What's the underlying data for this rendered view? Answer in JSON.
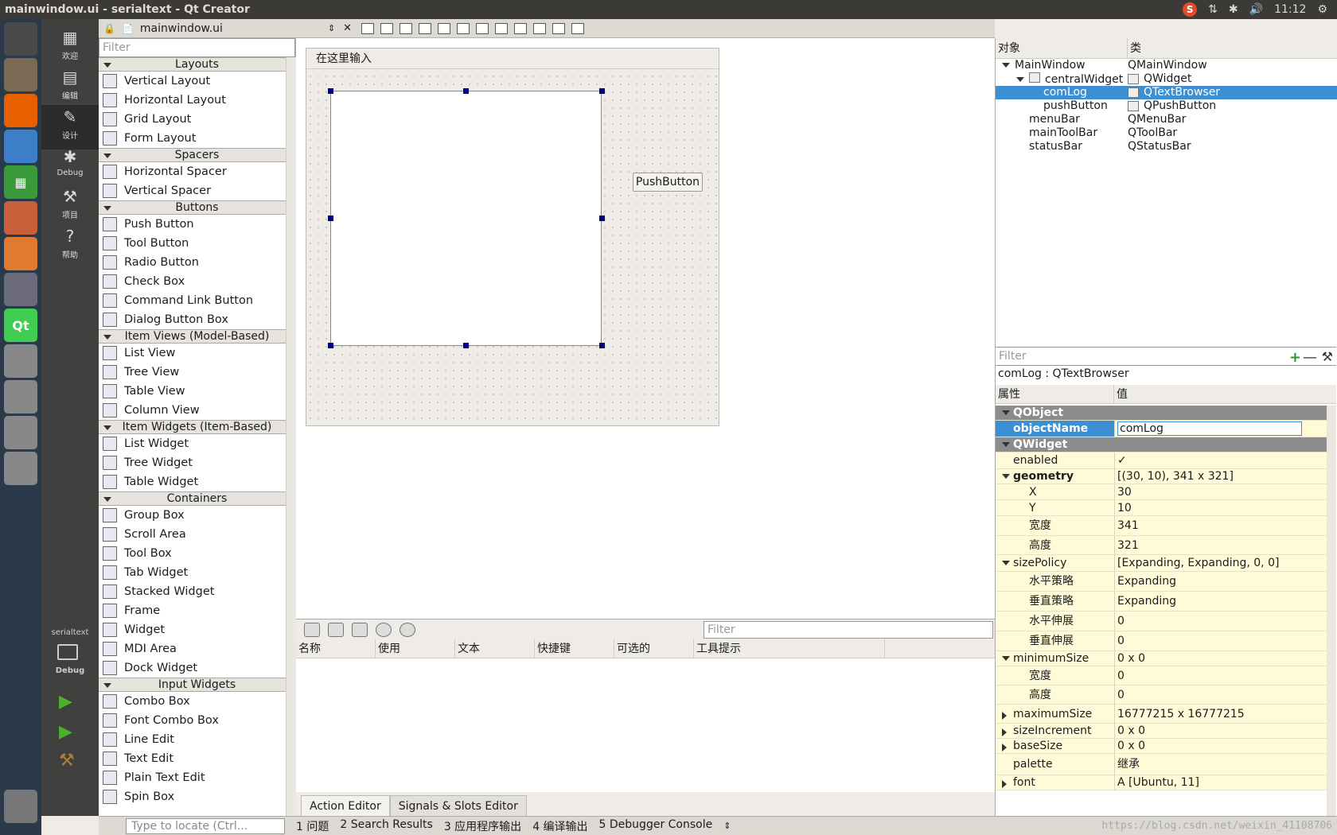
{
  "window": {
    "title": "mainwindow.ui - serialtext - Qt Creator",
    "time": "11:12"
  },
  "tray": {
    "sogou_label": "S"
  },
  "launcher": {
    "items": [
      "dash-icon",
      "files-icon",
      "firefox-icon",
      "writer-icon",
      "calc-icon",
      "impress-icon",
      "software-icon",
      "settings-icon",
      "qt-icon",
      "drive-icon",
      "drive-icon",
      "drive-icon",
      "drive-icon",
      "trash-icon"
    ],
    "qt_label": "Qt",
    "calc_label": "▦"
  },
  "modes": [
    {
      "label": "欢迎",
      "icon": "▦"
    },
    {
      "label": "编辑",
      "icon": "▤"
    },
    {
      "label": "设计",
      "icon": "✎"
    },
    {
      "label": "Debug",
      "icon": "✱"
    },
    {
      "label": "项目",
      "icon": "⚒"
    },
    {
      "label": "帮助",
      "icon": "?"
    }
  ],
  "kit": {
    "project": "serialtext",
    "mode": "Debug"
  },
  "runbar": {
    "run_icon": "▶",
    "debug_icon": "▶",
    "build_icon": "⚒"
  },
  "filetab": {
    "name": "mainwindow.ui"
  },
  "widgetbox": {
    "filter_placeholder": "Filter",
    "categories": [
      {
        "name": "Layouts",
        "items": [
          "Vertical Layout",
          "Horizontal Layout",
          "Grid Layout",
          "Form Layout"
        ]
      },
      {
        "name": "Spacers",
        "items": [
          "Horizontal Spacer",
          "Vertical Spacer"
        ]
      },
      {
        "name": "Buttons",
        "items": [
          "Push Button",
          "Tool Button",
          "Radio Button",
          "Check Box",
          "Command Link Button",
          "Dialog Button Box"
        ]
      },
      {
        "name": "Item Views (Model-Based)",
        "items": [
          "List View",
          "Tree View",
          "Table View",
          "Column View"
        ]
      },
      {
        "name": "Item Widgets (Item-Based)",
        "items": [
          "List Widget",
          "Tree Widget",
          "Table Widget"
        ]
      },
      {
        "name": "Containers",
        "items": [
          "Group Box",
          "Scroll Area",
          "Tool Box",
          "Tab Widget",
          "Stacked Widget",
          "Frame",
          "Widget",
          "MDI Area",
          "Dock Widget"
        ]
      },
      {
        "name": "Input Widgets",
        "items": [
          "Combo Box",
          "Font Combo Box",
          "Line Edit",
          "Text Edit",
          "Plain Text Edit",
          "Spin Box"
        ]
      }
    ]
  },
  "form": {
    "menu_placeholder": "在这里输入",
    "push_button": "PushButton"
  },
  "action_editor": {
    "filter_placeholder": "Filter",
    "columns": [
      "名称",
      "使用",
      "文本",
      "快捷键",
      "可选的",
      "工具提示"
    ],
    "tabs": [
      "Action Editor",
      "Signals & Slots Editor"
    ]
  },
  "object_inspector": {
    "col_object": "对象",
    "col_class": "类",
    "rows": [
      {
        "name": "MainWindow",
        "cls": "QMainWindow",
        "depth": 0,
        "expanded": true
      },
      {
        "name": "centralWidget",
        "cls": "QWidget",
        "depth": 1,
        "expanded": true
      },
      {
        "name": "comLog",
        "cls": "QTextBrowser",
        "depth": 2,
        "selected": true
      },
      {
        "name": "pushButton",
        "cls": "QPushButton",
        "depth": 2
      },
      {
        "name": "menuBar",
        "cls": "QMenuBar",
        "depth": 1
      },
      {
        "name": "mainToolBar",
        "cls": "QToolBar",
        "depth": 1
      },
      {
        "name": "statusBar",
        "cls": "QStatusBar",
        "depth": 1
      }
    ]
  },
  "property_editor": {
    "filter_placeholder": "Filter",
    "current": "comLog : QTextBrowser",
    "col_prop": "属性",
    "col_value": "值",
    "rows": [
      {
        "k": "QObject",
        "type": "sec"
      },
      {
        "k": "objectName",
        "v": "comLog",
        "type": "hl"
      },
      {
        "k": "QWidget",
        "type": "sec"
      },
      {
        "k": "enabled",
        "v": "✓"
      },
      {
        "k": "geometry",
        "v": "[(30, 10), 341 x 321]",
        "type": "bold",
        "tri": "d"
      },
      {
        "k": "X",
        "v": "30",
        "type": "sub"
      },
      {
        "k": "Y",
        "v": "10",
        "type": "sub"
      },
      {
        "k": "宽度",
        "v": "341",
        "type": "sub"
      },
      {
        "k": "高度",
        "v": "321",
        "type": "sub"
      },
      {
        "k": "sizePolicy",
        "v": "[Expanding, Expanding, 0, 0]",
        "tri": "d"
      },
      {
        "k": "水平策略",
        "v": "Expanding",
        "type": "sub"
      },
      {
        "k": "垂直策略",
        "v": "Expanding",
        "type": "sub"
      },
      {
        "k": "水平伸展",
        "v": "0",
        "type": "sub"
      },
      {
        "k": "垂直伸展",
        "v": "0",
        "type": "sub"
      },
      {
        "k": "minimumSize",
        "v": "0 x 0",
        "tri": "d"
      },
      {
        "k": "宽度",
        "v": "0",
        "type": "sub"
      },
      {
        "k": "高度",
        "v": "0",
        "type": "sub"
      },
      {
        "k": "maximumSize",
        "v": "16777215 x 16777215",
        "tri": "r"
      },
      {
        "k": "sizeIncrement",
        "v": "0 x 0",
        "tri": "r"
      },
      {
        "k": "baseSize",
        "v": "0 x 0",
        "tri": "r"
      },
      {
        "k": "palette",
        "v": "继承"
      },
      {
        "k": "font",
        "v": "A  [Ubuntu, 11]",
        "tri": "r"
      }
    ]
  },
  "statusbar": {
    "locate_placeholder": "Type to locate (Ctrl...",
    "tabs": [
      "1 问题",
      "2 Search Results",
      "3 应用程序输出",
      "4 编译输出",
      "5 Debugger Console"
    ]
  },
  "watermark": "https://blog.csdn.net/weixin_41108706"
}
